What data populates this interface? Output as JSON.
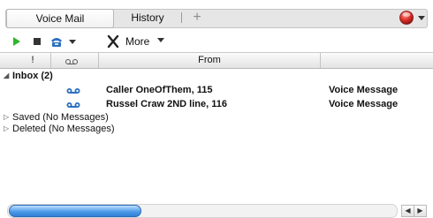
{
  "tabs": [
    {
      "label": "Voice Mail",
      "active": true
    },
    {
      "label": "History",
      "active": false
    }
  ],
  "toolbar": {
    "more_label": "More",
    "icons": [
      "play-icon",
      "stop-icon",
      "phone-icon",
      "delete-icon"
    ]
  },
  "columns": {
    "priority": "!",
    "type": "",
    "from": "From"
  },
  "inbox": {
    "label": "Inbox (2)",
    "messages": [
      {
        "from": "Caller OneOfThem, 115",
        "type": "Voice Message"
      },
      {
        "from": "Russel Craw 2ND line, 116",
        "type": "Voice Message"
      }
    ]
  },
  "folders": [
    {
      "label": "Saved (No Messages)"
    },
    {
      "label": "Deleted (No Messages)"
    }
  ],
  "colors": {
    "play": "#2fb52f",
    "accent": "#2a6fbf",
    "status_red": "#e0322b"
  }
}
